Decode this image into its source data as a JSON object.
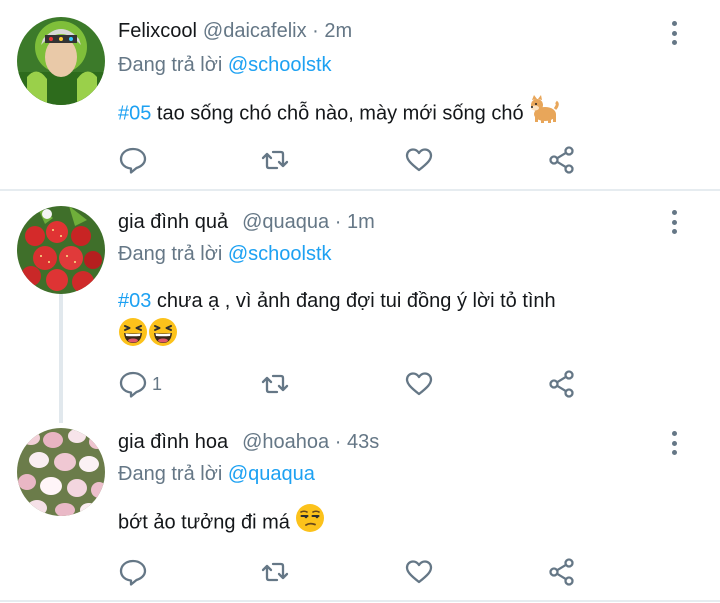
{
  "colors": {
    "accent": "#1da1f2",
    "muted": "#657786",
    "text": "#14171a",
    "divider": "#e6ecf0"
  },
  "tweets": [
    {
      "name": "Felixcool",
      "handle": "@daicafelix",
      "separator": "·",
      "time": "2m",
      "replying_prefix": "Đang trả lời",
      "replying_to": "@schoolstk",
      "hashtag": "#05",
      "text": " tao sống chó chỗ nào,  mày mới sống chó ",
      "emoji": "dog-emoji",
      "reply_count": "",
      "icons": [
        "reply-icon",
        "retweet-icon",
        "like-icon",
        "share-icon",
        "more-icon"
      ]
    },
    {
      "name": "gia đình quả",
      "handle": "@quaqua",
      "separator": "·",
      "time": "1m",
      "replying_prefix": "Đang trả lời",
      "replying_to": "@schoolstk",
      "hashtag": "#03",
      "text": " chưa ạ ,  vì ảnh đang đợi tui đồng ý lời tỏ tình",
      "emoji": "laughing-emoji",
      "reply_count": "1",
      "icons": [
        "reply-icon",
        "retweet-icon",
        "like-icon",
        "share-icon",
        "more-icon"
      ]
    },
    {
      "name": "gia đình hoa",
      "handle": "@hoahoa",
      "separator": "·",
      "time": "43s",
      "replying_prefix": "Đang trả lời",
      "replying_to": "@quaqua",
      "hashtag": "",
      "text": "bớt ảo tưởng đi má ",
      "emoji": "unamused-emoji",
      "reply_count": "",
      "icons": [
        "reply-icon",
        "retweet-icon",
        "like-icon",
        "share-icon",
        "more-icon"
      ]
    }
  ]
}
